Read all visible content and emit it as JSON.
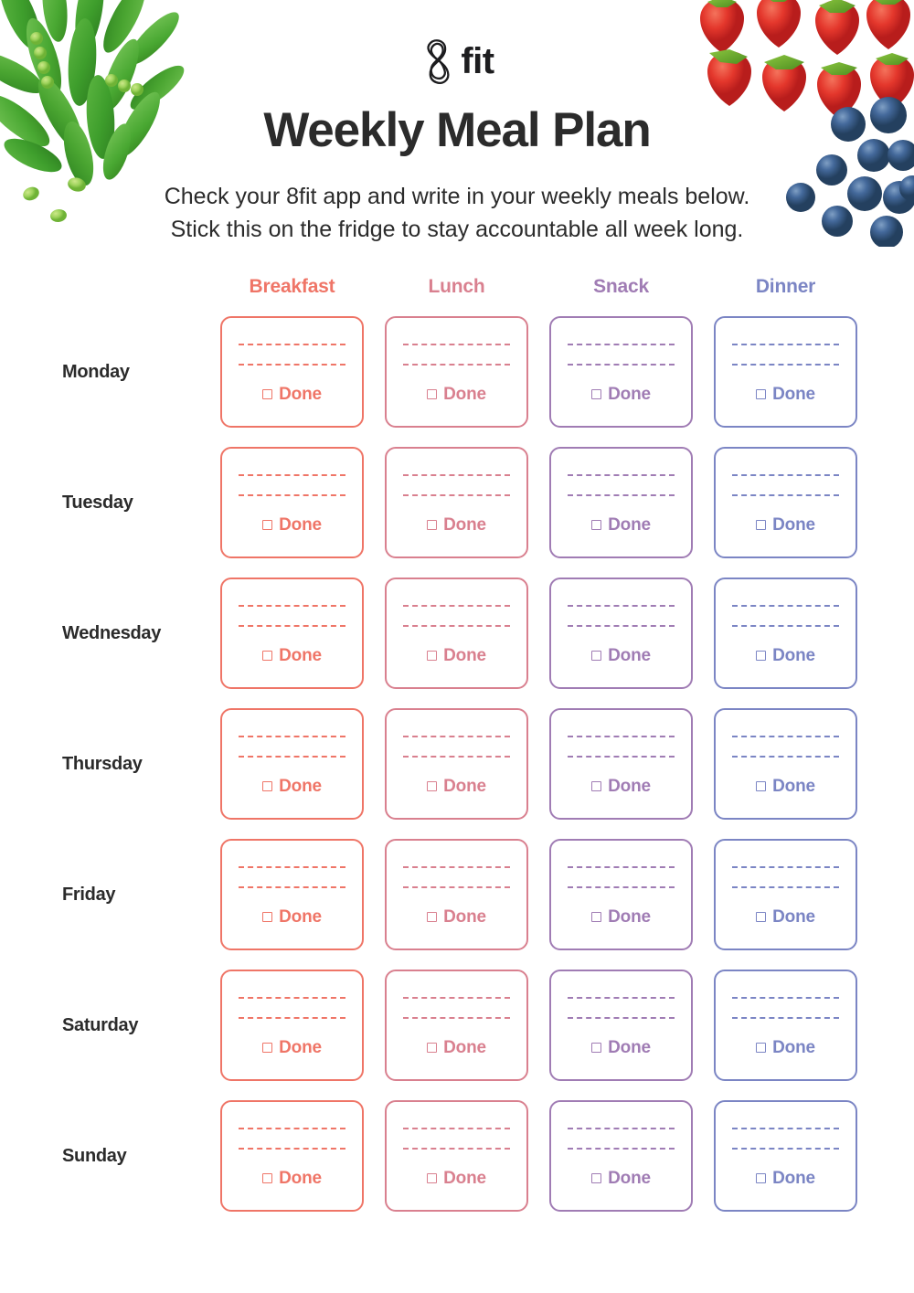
{
  "brand": {
    "logo_icon": "8fit-infinity-logo",
    "logo_text": "fit"
  },
  "header": {
    "title": "Weekly Meal Plan",
    "subtitle_line_1": "Check your 8fit app and write in your weekly meals below.",
    "subtitle_line_2": "Stick this on the fridge to stay accountable all week long."
  },
  "decor": {
    "top_left": "green-pea-pods-image",
    "top_right": "strawberries-and-blueberries-image"
  },
  "grid": {
    "columns": [
      {
        "label": "Breakfast",
        "color": "#ef7567"
      },
      {
        "label": "Lunch",
        "color": "#d9808f"
      },
      {
        "label": "Snack",
        "color": "#a07cb4"
      },
      {
        "label": "Dinner",
        "color": "#7b85c4"
      }
    ],
    "days": [
      "Monday",
      "Tuesday",
      "Wednesday",
      "Thursday",
      "Friday",
      "Saturday",
      "Sunday"
    ],
    "card": {
      "done_label": "Done",
      "checkbox_icon": "empty-checkbox-icon",
      "write_lines": 2
    }
  }
}
